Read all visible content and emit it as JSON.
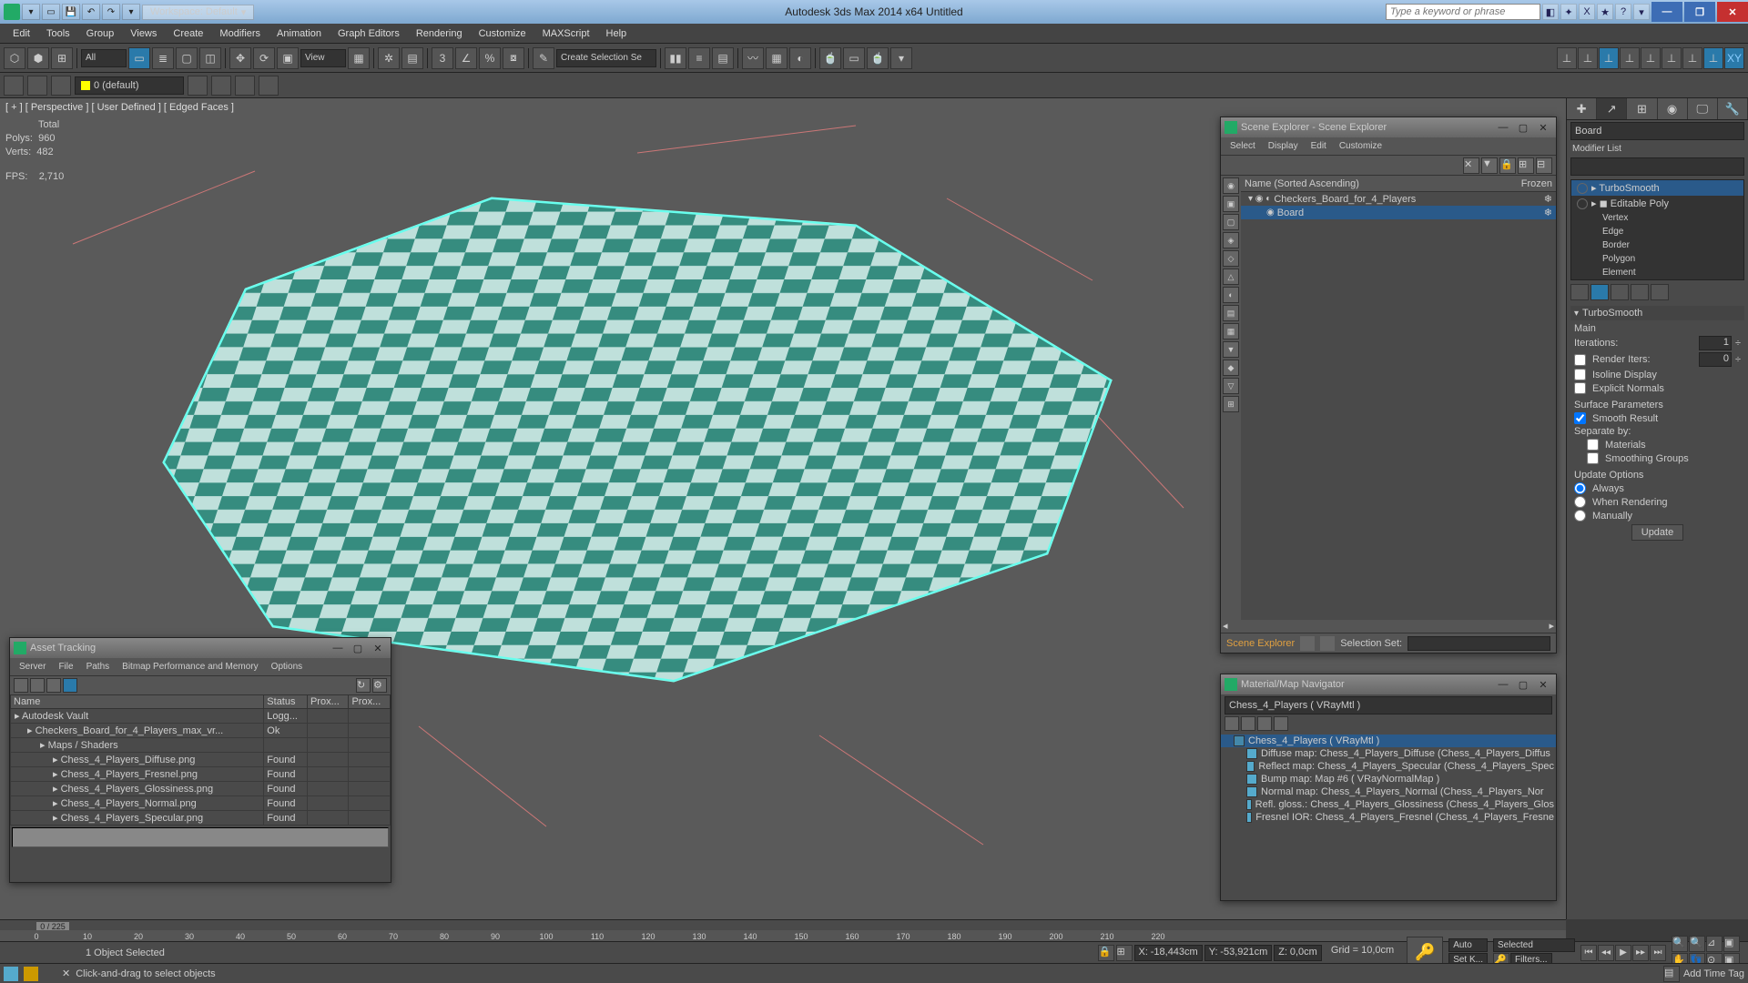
{
  "app": {
    "title": "Autodesk 3ds Max 2014 x64    Untitled",
    "workspace_label": "Workspace: Default",
    "search_placeholder": "Type a keyword or phrase"
  },
  "menus": [
    "Edit",
    "Tools",
    "Group",
    "Views",
    "Create",
    "Modifiers",
    "Animation",
    "Graph Editors",
    "Rendering",
    "Customize",
    "MAXScript",
    "Help"
  ],
  "maintb": {
    "filter": "All",
    "view": "View",
    "sel_set": "Create Selection Se"
  },
  "layer": "0 (default)",
  "viewport": {
    "label": "[ + ] [ Perspective ] [ User Defined ] [ Edged Faces ]",
    "stats_total": "Total",
    "polys_label": "Polys:",
    "polys": "960",
    "verts_label": "Verts:",
    "verts": "482",
    "fps_label": "FPS:",
    "fps": "2,710"
  },
  "cmdpanel": {
    "obj_name": "Board",
    "modlist_label": "Modifier List",
    "stack": [
      "TurboSmooth",
      "Editable Poly",
      "Vertex",
      "Edge",
      "Border",
      "Polygon",
      "Element"
    ],
    "rollout_head": "TurboSmooth",
    "main_label": "Main",
    "iter_label": "Iterations:",
    "iter": "1",
    "render_label": "Render Iters:",
    "render": "0",
    "isoline": "Isoline Display",
    "normals": "Explicit Normals",
    "surface_head": "Surface Parameters",
    "smooth": "Smooth Result",
    "sep_label": "Separate by:",
    "materials": "Materials",
    "smgroups": "Smoothing Groups",
    "upd_head": "Update Options",
    "upd_always": "Always",
    "upd_render": "When Rendering",
    "upd_manual": "Manually",
    "upd_btn": "Update"
  },
  "scene_explorer": {
    "title": "Scene Explorer - Scene Explorer",
    "menus": [
      "Select",
      "Display",
      "Edit",
      "Customize"
    ],
    "col_name": "Name (Sorted Ascending)",
    "col_frozen": "Frozen",
    "root": "Checkers_Board_for_4_Players",
    "child": "Board",
    "foot_tab": "Scene Explorer",
    "selset_label": "Selection Set:"
  },
  "asset_tracking": {
    "title": "Asset Tracking",
    "menus": [
      "Server",
      "File",
      "Paths",
      "Bitmap Performance and Memory",
      "Options"
    ],
    "cols": [
      "Name",
      "Status",
      "Prox...",
      "Prox..."
    ],
    "rows": [
      {
        "name": "Autodesk Vault",
        "status": "Logg..."
      },
      {
        "name": "Checkers_Board_for_4_Players_max_vr...",
        "status": "Ok"
      },
      {
        "name": "Maps / Shaders",
        "status": ""
      },
      {
        "name": "Chess_4_Players_Diffuse.png",
        "status": "Found"
      },
      {
        "name": "Chess_4_Players_Fresnel.png",
        "status": "Found"
      },
      {
        "name": "Chess_4_Players_Glossiness.png",
        "status": "Found"
      },
      {
        "name": "Chess_4_Players_Normal.png",
        "status": "Found"
      },
      {
        "name": "Chess_4_Players_Specular.png",
        "status": "Found"
      }
    ]
  },
  "mat_nav": {
    "title": "Material/Map Navigator",
    "current": "Chess_4_Players  ( VRayMtl )",
    "root": "Chess_4_Players  ( VRayMtl )",
    "maps": [
      "Diffuse map: Chess_4_Players_Diffuse (Chess_4_Players_Diffus",
      "Reflect map: Chess_4_Players_Specular (Chess_4_Players_Spec",
      "Bump map: Map #6  ( VRayNormalMap )",
      "Normal map: Chess_4_Players_Normal (Chess_4_Players_Nor",
      "Refl. gloss.: Chess_4_Players_Glossiness (Chess_4_Players_Glos",
      "Fresnel IOR: Chess_4_Players_Fresnel (Chess_4_Players_Fresne"
    ]
  },
  "timeline": {
    "frame": "0 / 225",
    "ticks": [
      0,
      10,
      20,
      30,
      40,
      50,
      60,
      70,
      80,
      90,
      100,
      110,
      120,
      130,
      140,
      150,
      160,
      170,
      180,
      190,
      200,
      210,
      220
    ]
  },
  "status": {
    "selected": "1 Object Selected",
    "x_label": "X:",
    "x": "-18,443cm",
    "y_label": "Y:",
    "y": "-53,921cm",
    "z_label": "Z:",
    "z": "0,0cm",
    "grid": "Grid = 10,0cm",
    "auto": "Auto",
    "sel_dd": "Selected",
    "setk": "Set K...",
    "filters": "Filters..."
  },
  "prompt": {
    "hint": "Click-and-drag to select objects",
    "addtag": "Add Time Tag"
  }
}
